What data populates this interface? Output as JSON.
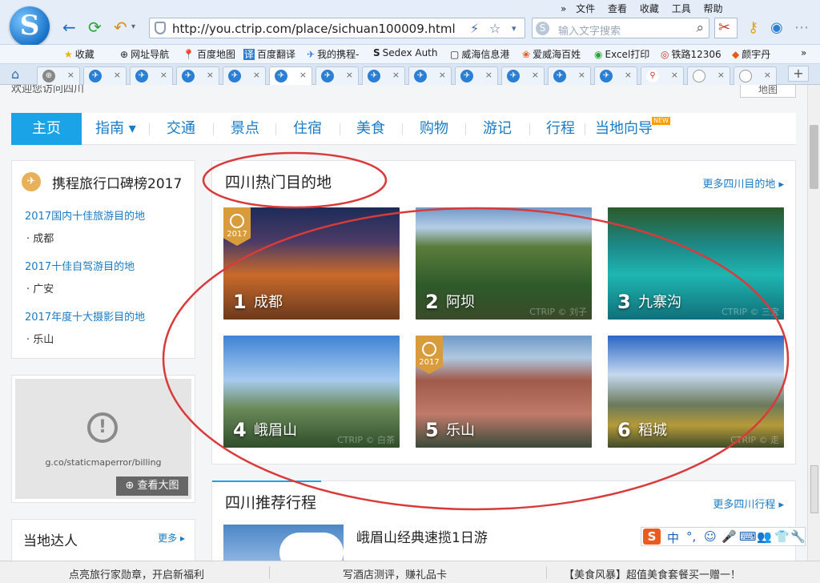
{
  "browser": {
    "url": "http://you.ctrip.com/place/sichuan100009.html",
    "search_placeholder": "输入文字搜索",
    "menu": [
      "文件",
      "查看",
      "收藏",
      "工具",
      "帮助"
    ]
  },
  "bookmarks": [
    {
      "icon": "★",
      "label": "收藏"
    },
    {
      "icon": "⊕",
      "label": "网址导航"
    },
    {
      "icon": "📍",
      "label": "百度地图"
    },
    {
      "icon": "译",
      "label": "百度翻译"
    },
    {
      "icon": "✈",
      "label": "我的携程-"
    },
    {
      "icon": "S",
      "label": "Sedex Auth"
    },
    {
      "icon": "▢",
      "label": "威海信息港"
    },
    {
      "icon": "❀",
      "label": "爱威海百姓"
    },
    {
      "icon": "◉",
      "label": "Excel打印"
    },
    {
      "icon": "◎",
      "label": "铁路12306"
    },
    {
      "icon": "◆",
      "label": "颜宇丹"
    }
  ],
  "page": {
    "welcome": "欢迎您访问四川",
    "map_button": "地图",
    "nav": [
      {
        "label": "主页"
      },
      {
        "label": "指南 ▾"
      },
      {
        "label": "交通"
      },
      {
        "label": "景点"
      },
      {
        "label": "住宿"
      },
      {
        "label": "美食"
      },
      {
        "label": "购物"
      },
      {
        "label": "游记"
      },
      {
        "label": "行程"
      },
      {
        "label": "当地向导"
      }
    ],
    "nav_new_badge": "NEW",
    "award": {
      "title": "携程旅行口碑榜2017",
      "items": [
        {
          "category": "2017国内十佳旅游目的地",
          "winner": "成都"
        },
        {
          "category": "2017十佳自驾游目的地",
          "winner": "广安"
        },
        {
          "category": "2017年度十大摄影目的地",
          "winner": "乐山"
        }
      ]
    },
    "map": {
      "error_text": "g.co/staticmaperror/billing",
      "view_large": "⊕ 查看大图"
    },
    "expert": {
      "title": "当地达人",
      "more": "更多 ▸"
    },
    "hot": {
      "heading": "四川热门目的地",
      "more": "更多四川目的地 ▸",
      "destinations": [
        {
          "rank": "1",
          "name": "成都",
          "badge": "2017",
          "watermark": ""
        },
        {
          "rank": "2",
          "name": "阿坝",
          "badge": "",
          "watermark": "CTRIP © 刘子"
        },
        {
          "rank": "3",
          "name": "九寨沟",
          "badge": "",
          "watermark": "CTRIP © 三宝"
        },
        {
          "rank": "4",
          "name": "峨眉山",
          "badge": "",
          "watermark": "CTRIP © 白茶"
        },
        {
          "rank": "5",
          "name": "乐山",
          "badge": "2017",
          "watermark": ""
        },
        {
          "rank": "6",
          "name": "稻城",
          "badge": "",
          "watermark": "CTRIP © 走"
        }
      ]
    },
    "recommend": {
      "heading": "四川推荐行程",
      "more": "更多四川行程 ▸",
      "first_trip": "峨眉山经典速揽1日游"
    }
  },
  "ime": {
    "logo": "S",
    "keys": [
      "中",
      "°,",
      "☺",
      "🎤",
      "⌨",
      "👥",
      "👕",
      "🔧"
    ]
  },
  "statusbar": {
    "left": "点亮旅行家勋章，开启新福利",
    "middle": "写酒店测评，赚礼品卡",
    "right": "【美食风暴】超值美食套餐买一赠一！"
  }
}
